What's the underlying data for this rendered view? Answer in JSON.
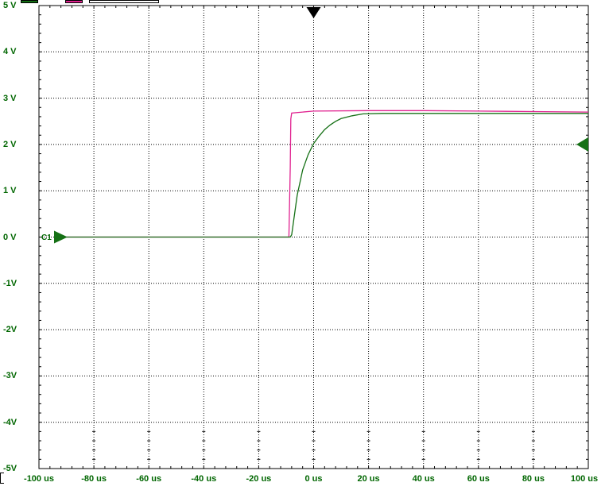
{
  "chart_data": {
    "type": "line",
    "xlabel": "",
    "ylabel": "",
    "xlim": [
      -100,
      100
    ],
    "ylim": [
      -5,
      5
    ],
    "grid": true,
    "x_tick_labels": [
      "-100 us",
      "-80 us",
      "-60 us",
      "-40 us",
      "-20 us",
      "0 us",
      "20 us",
      "40 us",
      "60 us",
      "80 us",
      "100 us"
    ],
    "y_tick_labels": [
      "5 V",
      "4 V",
      "3 V",
      "2 V",
      "1 V",
      "0 V",
      "-1V",
      "-2V",
      "-3V",
      "-4V",
      "-5V"
    ],
    "channel_marker_label": "C1",
    "series": [
      {
        "color": "#e0208f",
        "x": [
          -90,
          -9,
          -8.5,
          -8.3,
          -8,
          0,
          20,
          40,
          60,
          80,
          100
        ],
        "y": [
          0,
          0,
          1.5,
          2.55,
          2.68,
          2.72,
          2.73,
          2.73,
          2.72,
          2.71,
          2.7
        ]
      },
      {
        "color": "#157015",
        "x": [
          -90,
          -8.5,
          -8,
          -6,
          -4,
          -2,
          0,
          2,
          4,
          6,
          8,
          10,
          14,
          18,
          25,
          40,
          60,
          80,
          100
        ],
        "y": [
          0,
          0,
          0.05,
          0.9,
          1.45,
          1.78,
          2.02,
          2.18,
          2.32,
          2.42,
          2.5,
          2.56,
          2.62,
          2.66,
          2.67,
          2.67,
          2.67,
          2.67,
          2.67
        ]
      }
    ]
  },
  "toolbar": {
    "channel_colors": [
      "#157015",
      "#e0208f"
    ]
  },
  "markers": {
    "trigger_color": "#000000",
    "marker_color": "#157015",
    "trigger_level_v": 2,
    "ground_level_v": 0,
    "trigger_time_us": 0
  }
}
